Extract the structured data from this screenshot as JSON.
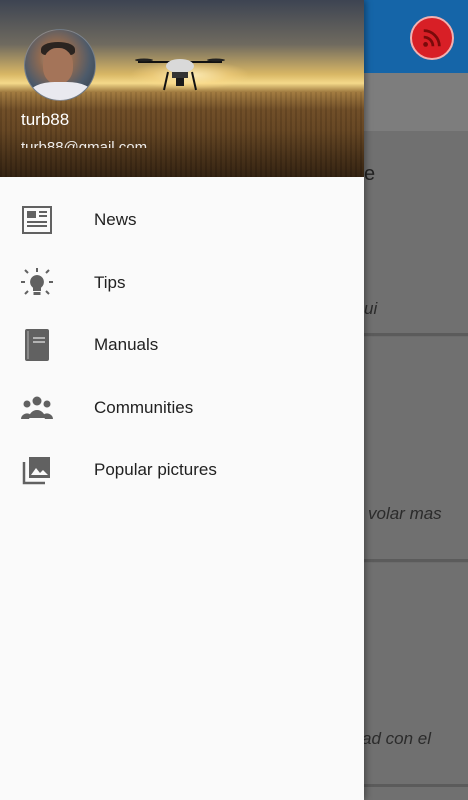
{
  "drawer": {
    "header": {
      "username": "turb88",
      "email": "turb88@gmail.com"
    },
    "items": [
      {
        "label": "News",
        "icon": "newspaper-icon"
      },
      {
        "label": "Tips",
        "icon": "lightbulb-icon"
      },
      {
        "label": "Manuals",
        "icon": "book-icon"
      },
      {
        "label": "Communities",
        "icon": "group-icon"
      },
      {
        "label": "Popular pictures",
        "icon": "photo-library-icon"
      }
    ]
  },
  "background": {
    "fragments": [
      "e",
      "ui",
      "volar mas",
      "ad con el"
    ]
  },
  "colors": {
    "toolbar": "#1565a8",
    "rss": "#d81f26",
    "drawer_bg": "#fafafa",
    "icon_gray": "#616161"
  }
}
